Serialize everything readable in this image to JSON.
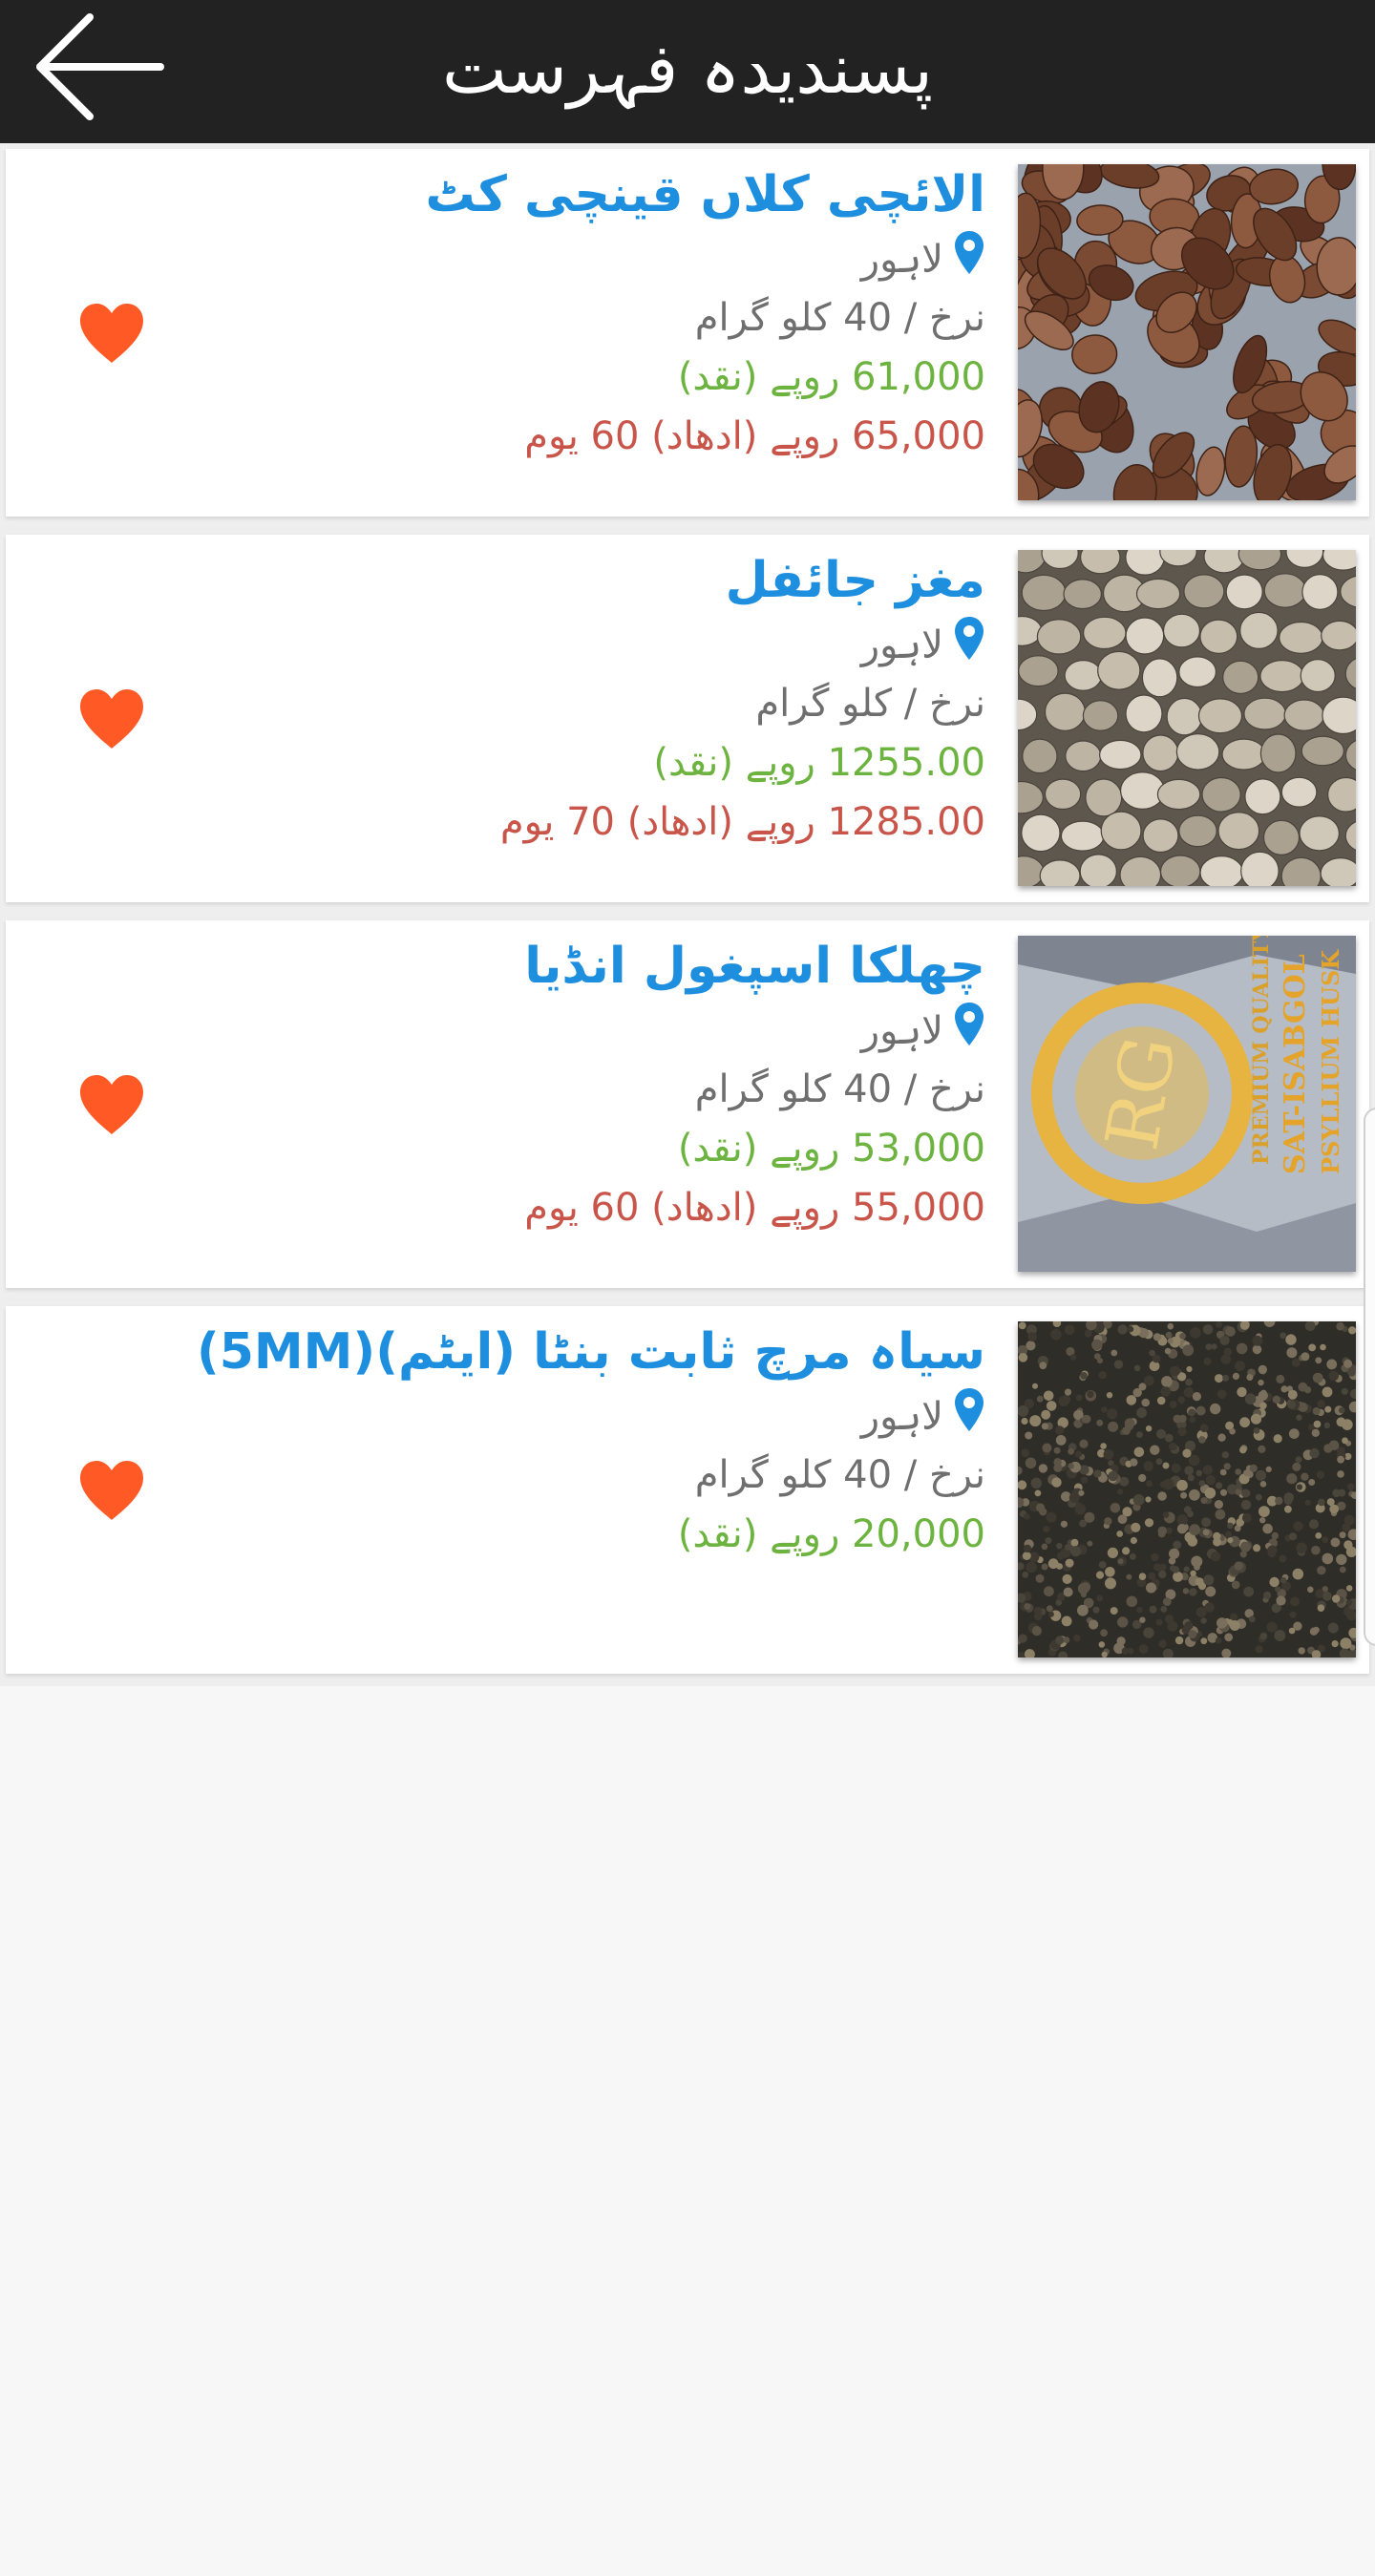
{
  "header": {
    "title": "پسندیدہ فہرست",
    "back_icon": "arrow-left-icon"
  },
  "colors": {
    "header_bg": "#222222",
    "title_blue": "#1e8fdf",
    "cash_green": "#6db33f",
    "credit_red": "#c9554a",
    "heart_orange": "#ff5a26",
    "pin_blue": "#1e8fdf"
  },
  "items": [
    {
      "title": "الائچی کلاں قینچی کٹ",
      "location": "لاہور",
      "rate": "نرخ / 40 کلو گرام",
      "cash_price": "61,000 روپے (نقد)",
      "credit_price": "65,000 روپے (ادھاد) 60 یوم",
      "image": "cardamom"
    },
    {
      "title": "مغز جائفل",
      "location": "لاہور",
      "rate": "نرخ / کلو گرام",
      "cash_price": "1255.00 روپے (نقد)",
      "credit_price": "1285.00 روپے (ادھاد) 70 یوم",
      "image": "nutmeg"
    },
    {
      "title": "چھلکا اسپغول انڈیا",
      "location": "لاہور",
      "rate": "نرخ / 40 کلو گرام",
      "cash_price": "53,000 روپے (نقد)",
      "credit_price": "55,000 روپے (ادھاد) 60 یوم",
      "image": "psyllium-bag",
      "image_text": [
        "RG",
        "PREMIUM QUALITY",
        "SAT-ISABGOL",
        "PSYLLIUM HUSK"
      ]
    },
    {
      "title": "سیاہ مرچ ثابت بنٹا (ایٹم)(5MM)",
      "location": "لاہور",
      "rate": "نرخ / 40 کلو گرام",
      "cash_price": "20,000 روپے (نقد)",
      "credit_price": "",
      "image": "black-pepper"
    }
  ]
}
